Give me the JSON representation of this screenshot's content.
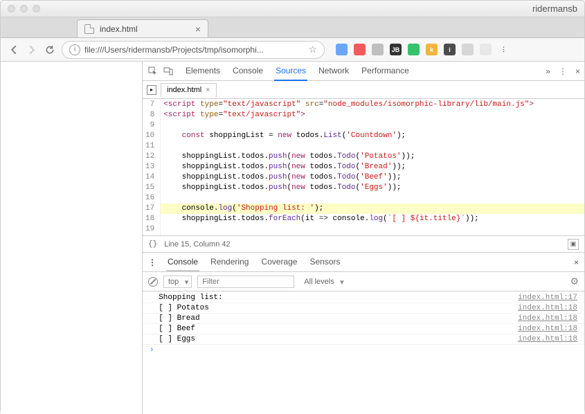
{
  "window": {
    "user": "ridermansb"
  },
  "browser_tab": {
    "label": "index.html"
  },
  "address": {
    "url": "file:///Users/ridermansb/Projects/tmp/isomorphi..."
  },
  "extensions": [
    {
      "name": "translate",
      "bg": "#6aa7f8",
      "glyph": ""
    },
    {
      "name": "ext-red",
      "bg": "#f15b5b",
      "glyph": ""
    },
    {
      "name": "ext-grey1",
      "bg": "#bfbfbf",
      "glyph": ""
    },
    {
      "name": "ext-jb",
      "bg": "#333333",
      "glyph": "JB"
    },
    {
      "name": "ext-green",
      "bg": "#35c26b",
      "glyph": ""
    },
    {
      "name": "ext-k",
      "bg": "#f3b43a",
      "glyph": "k"
    },
    {
      "name": "ext-info",
      "bg": "#4b4b4b",
      "glyph": "i"
    },
    {
      "name": "ext-grey2",
      "bg": "#d6d6d6",
      "glyph": ""
    },
    {
      "name": "ext-cloud",
      "bg": "#e8e8e8",
      "glyph": ""
    },
    {
      "name": "ext-menu",
      "bg": "transparent",
      "glyph": "⋮"
    }
  ],
  "devtools": {
    "tabs": [
      "Elements",
      "Console",
      "Sources",
      "Network",
      "Performance"
    ],
    "active_tab": "Sources",
    "file_tab": "index.html",
    "gutter": [
      "7",
      "8",
      "9",
      "10",
      "11",
      "12",
      "13",
      "14",
      "15",
      "16",
      "17",
      "18",
      "19"
    ],
    "status": "Line 15, Column 42"
  },
  "drawer": {
    "tabs": [
      "Console",
      "Rendering",
      "Coverage",
      "Sensors"
    ],
    "active": "Console",
    "context": "top",
    "filter_placeholder": "Filter",
    "levels": "All levels"
  },
  "console_rows": [
    {
      "msg": "Shopping list:",
      "src": "index.html:17"
    },
    {
      "msg": "[ ] Potatos",
      "src": "index.html:18"
    },
    {
      "msg": "[ ] Bread",
      "src": "index.html:18"
    },
    {
      "msg": "[ ] Beef",
      "src": "index.html:18"
    },
    {
      "msg": "[ ] Eggs",
      "src": "index.html:18"
    }
  ],
  "code": {
    "lines": [
      {
        "n": 7,
        "html": "<span class='tag'>&lt;script</span> <span class='attr'>type</span>=<span class='str'>\"text/javascript\"</span> <span class='attr'>src</span>=<span class='str'>\"node_modules/isomorphic-library/lib/main.js\"</span><span class='tag'>&gt;</span>"
      },
      {
        "n": 8,
        "html": "<span class='tag'>&lt;script</span> <span class='attr'>type</span>=<span class='str'>\"text/javascript\"</span><span class='tag'>&gt;</span>"
      },
      {
        "n": 9,
        "html": ""
      },
      {
        "n": 10,
        "html": "    <span class='kw'>const</span> <span class='id'>shoppingList</span> = <span class='new'>new</span> <span class='id'>todos</span>.<span class='fn'>List</span>(<span class='str'>'Countdown'</span>);"
      },
      {
        "n": 11,
        "html": ""
      },
      {
        "n": 12,
        "html": "    <span class='id'>shoppingList.todos</span>.<span class='fn'>push</span>(<span class='new'>new</span> <span class='id'>todos</span>.<span class='fn'>Todo</span>(<span class='str'>'Potatos'</span>));"
      },
      {
        "n": 13,
        "html": "    <span class='id'>shoppingList.todos</span>.<span class='fn'>push</span>(<span class='new'>new</span> <span class='id'>todos</span>.<span class='fn'>Todo</span>(<span class='str'>'Bread'</span>));"
      },
      {
        "n": 14,
        "html": "    <span class='id'>shoppingList.todos</span>.<span class='fn'>push</span>(<span class='new'>new</span> <span class='id'>todos</span>.<span class='fn'>Todo</span>(<span class='str'>'Beef'</span>));"
      },
      {
        "n": 15,
        "html": "    <span class='id'>shoppingList.todos</span>.<span class='fn'>push</span>(<span class='new'>new</span> <span class='id'>todos</span>.<span class='fn'>Todo</span>(<span class='str'>'Eggs'</span>));"
      },
      {
        "n": 16,
        "html": ""
      },
      {
        "n": 17,
        "hl": true,
        "html": "    <span class='id'>console</span>.<span class='fn'>log</span>(<span class='str'>'Shopping list: '</span>);"
      },
      {
        "n": 18,
        "html": "    <span class='id'>shoppingList.todos</span>.<span class='fn'>forEach</span>(<span class='id'>it</span> <span class='op'>=&gt;</span> <span class='id'>console</span>.<span class='fn'>log</span>(<span class='str'>`[ ] ${it.title}`</span>));"
      },
      {
        "n": 19,
        "html": ""
      }
    ]
  }
}
